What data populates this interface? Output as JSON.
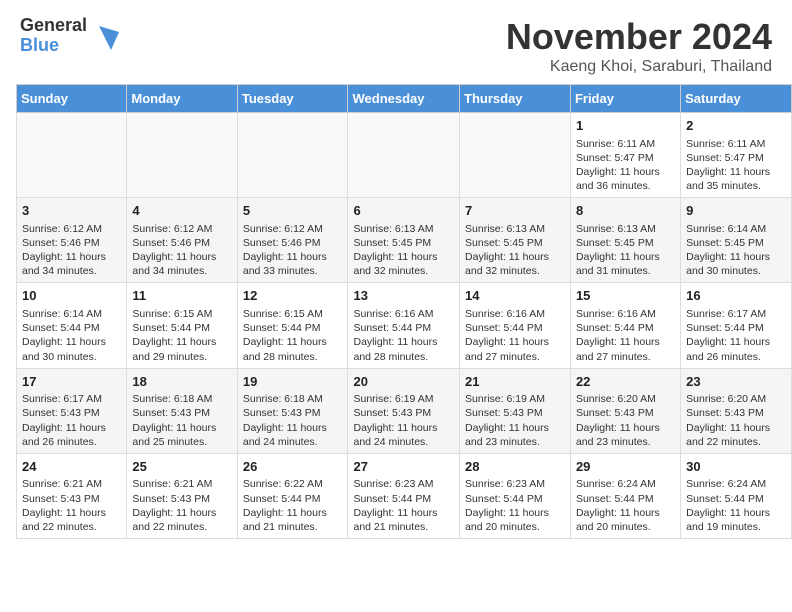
{
  "header": {
    "logo_general": "General",
    "logo_blue": "Blue",
    "month_title": "November 2024",
    "location": "Kaeng Khoi, Saraburi, Thailand"
  },
  "weekdays": [
    "Sunday",
    "Monday",
    "Tuesday",
    "Wednesday",
    "Thursday",
    "Friday",
    "Saturday"
  ],
  "weeks": [
    [
      {
        "day": "",
        "info": ""
      },
      {
        "day": "",
        "info": ""
      },
      {
        "day": "",
        "info": ""
      },
      {
        "day": "",
        "info": ""
      },
      {
        "day": "",
        "info": ""
      },
      {
        "day": "1",
        "info": "Sunrise: 6:11 AM\nSunset: 5:47 PM\nDaylight: 11 hours and 36 minutes."
      },
      {
        "day": "2",
        "info": "Sunrise: 6:11 AM\nSunset: 5:47 PM\nDaylight: 11 hours and 35 minutes."
      }
    ],
    [
      {
        "day": "3",
        "info": "Sunrise: 6:12 AM\nSunset: 5:46 PM\nDaylight: 11 hours and 34 minutes."
      },
      {
        "day": "4",
        "info": "Sunrise: 6:12 AM\nSunset: 5:46 PM\nDaylight: 11 hours and 34 minutes."
      },
      {
        "day": "5",
        "info": "Sunrise: 6:12 AM\nSunset: 5:46 PM\nDaylight: 11 hours and 33 minutes."
      },
      {
        "day": "6",
        "info": "Sunrise: 6:13 AM\nSunset: 5:45 PM\nDaylight: 11 hours and 32 minutes."
      },
      {
        "day": "7",
        "info": "Sunrise: 6:13 AM\nSunset: 5:45 PM\nDaylight: 11 hours and 32 minutes."
      },
      {
        "day": "8",
        "info": "Sunrise: 6:13 AM\nSunset: 5:45 PM\nDaylight: 11 hours and 31 minutes."
      },
      {
        "day": "9",
        "info": "Sunrise: 6:14 AM\nSunset: 5:45 PM\nDaylight: 11 hours and 30 minutes."
      }
    ],
    [
      {
        "day": "10",
        "info": "Sunrise: 6:14 AM\nSunset: 5:44 PM\nDaylight: 11 hours and 30 minutes."
      },
      {
        "day": "11",
        "info": "Sunrise: 6:15 AM\nSunset: 5:44 PM\nDaylight: 11 hours and 29 minutes."
      },
      {
        "day": "12",
        "info": "Sunrise: 6:15 AM\nSunset: 5:44 PM\nDaylight: 11 hours and 28 minutes."
      },
      {
        "day": "13",
        "info": "Sunrise: 6:16 AM\nSunset: 5:44 PM\nDaylight: 11 hours and 28 minutes."
      },
      {
        "day": "14",
        "info": "Sunrise: 6:16 AM\nSunset: 5:44 PM\nDaylight: 11 hours and 27 minutes."
      },
      {
        "day": "15",
        "info": "Sunrise: 6:16 AM\nSunset: 5:44 PM\nDaylight: 11 hours and 27 minutes."
      },
      {
        "day": "16",
        "info": "Sunrise: 6:17 AM\nSunset: 5:44 PM\nDaylight: 11 hours and 26 minutes."
      }
    ],
    [
      {
        "day": "17",
        "info": "Sunrise: 6:17 AM\nSunset: 5:43 PM\nDaylight: 11 hours and 26 minutes."
      },
      {
        "day": "18",
        "info": "Sunrise: 6:18 AM\nSunset: 5:43 PM\nDaylight: 11 hours and 25 minutes."
      },
      {
        "day": "19",
        "info": "Sunrise: 6:18 AM\nSunset: 5:43 PM\nDaylight: 11 hours and 24 minutes."
      },
      {
        "day": "20",
        "info": "Sunrise: 6:19 AM\nSunset: 5:43 PM\nDaylight: 11 hours and 24 minutes."
      },
      {
        "day": "21",
        "info": "Sunrise: 6:19 AM\nSunset: 5:43 PM\nDaylight: 11 hours and 23 minutes."
      },
      {
        "day": "22",
        "info": "Sunrise: 6:20 AM\nSunset: 5:43 PM\nDaylight: 11 hours and 23 minutes."
      },
      {
        "day": "23",
        "info": "Sunrise: 6:20 AM\nSunset: 5:43 PM\nDaylight: 11 hours and 22 minutes."
      }
    ],
    [
      {
        "day": "24",
        "info": "Sunrise: 6:21 AM\nSunset: 5:43 PM\nDaylight: 11 hours and 22 minutes."
      },
      {
        "day": "25",
        "info": "Sunrise: 6:21 AM\nSunset: 5:43 PM\nDaylight: 11 hours and 22 minutes."
      },
      {
        "day": "26",
        "info": "Sunrise: 6:22 AM\nSunset: 5:44 PM\nDaylight: 11 hours and 21 minutes."
      },
      {
        "day": "27",
        "info": "Sunrise: 6:23 AM\nSunset: 5:44 PM\nDaylight: 11 hours and 21 minutes."
      },
      {
        "day": "28",
        "info": "Sunrise: 6:23 AM\nSunset: 5:44 PM\nDaylight: 11 hours and 20 minutes."
      },
      {
        "day": "29",
        "info": "Sunrise: 6:24 AM\nSunset: 5:44 PM\nDaylight: 11 hours and 20 minutes."
      },
      {
        "day": "30",
        "info": "Sunrise: 6:24 AM\nSunset: 5:44 PM\nDaylight: 11 hours and 19 minutes."
      }
    ]
  ]
}
